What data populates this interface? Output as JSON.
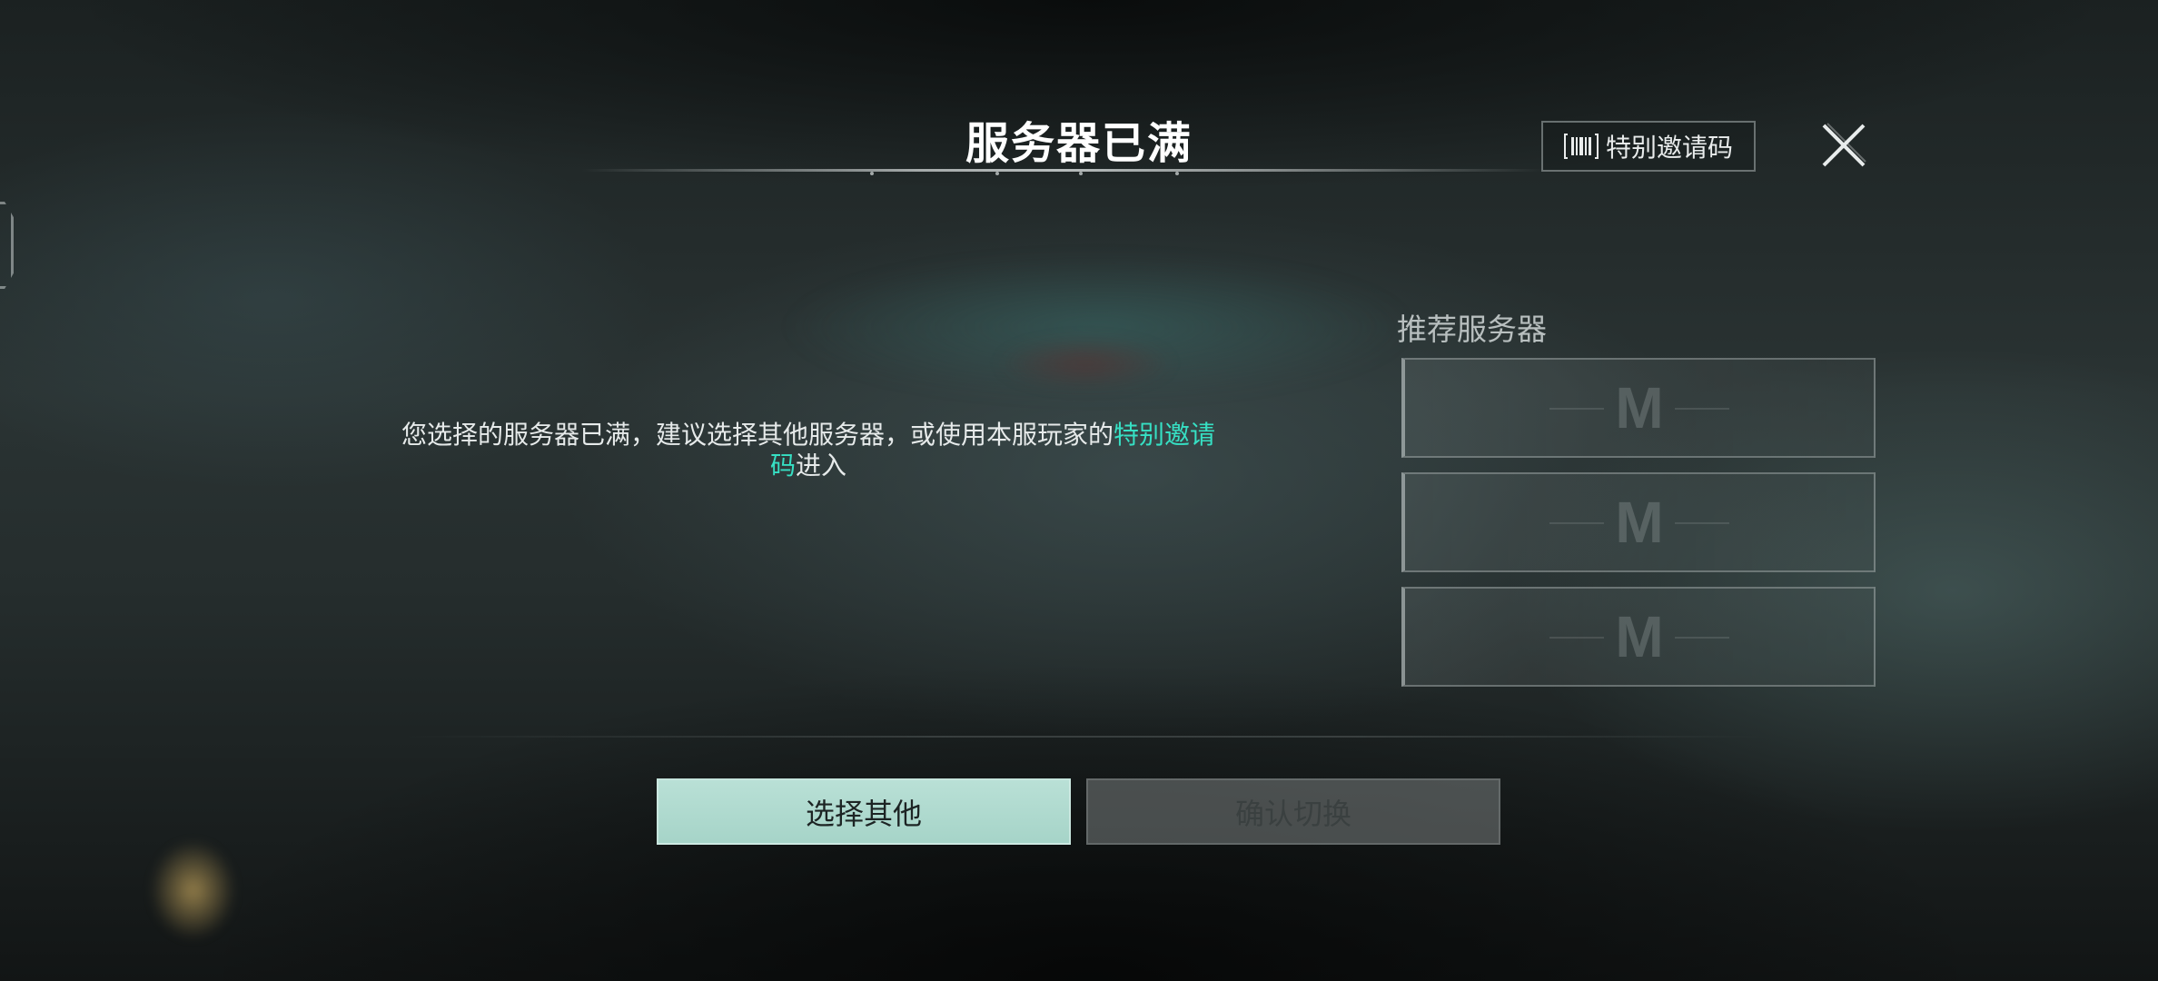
{
  "header": {
    "title": "服务器已满",
    "invite_label": "特别邀请码",
    "invite_icon": "barcode-icon",
    "close_icon": "close-icon"
  },
  "message": {
    "text": "您选择的服务器已满，建议选择其他服务器，或使用本服玩家的",
    "highlight": "特别邀请码",
    "suffix": "进入"
  },
  "recommended": {
    "title": "推荐服务器",
    "slots": [
      {
        "logo": "M"
      },
      {
        "logo": "M"
      },
      {
        "logo": "M"
      }
    ]
  },
  "buttons": {
    "select_other": "选择其他",
    "confirm_switch": "确认切换"
  },
  "colors": {
    "accent": "#36e0c4",
    "primary_button": "#b9e0d6",
    "disabled_button": "#787e7e"
  }
}
